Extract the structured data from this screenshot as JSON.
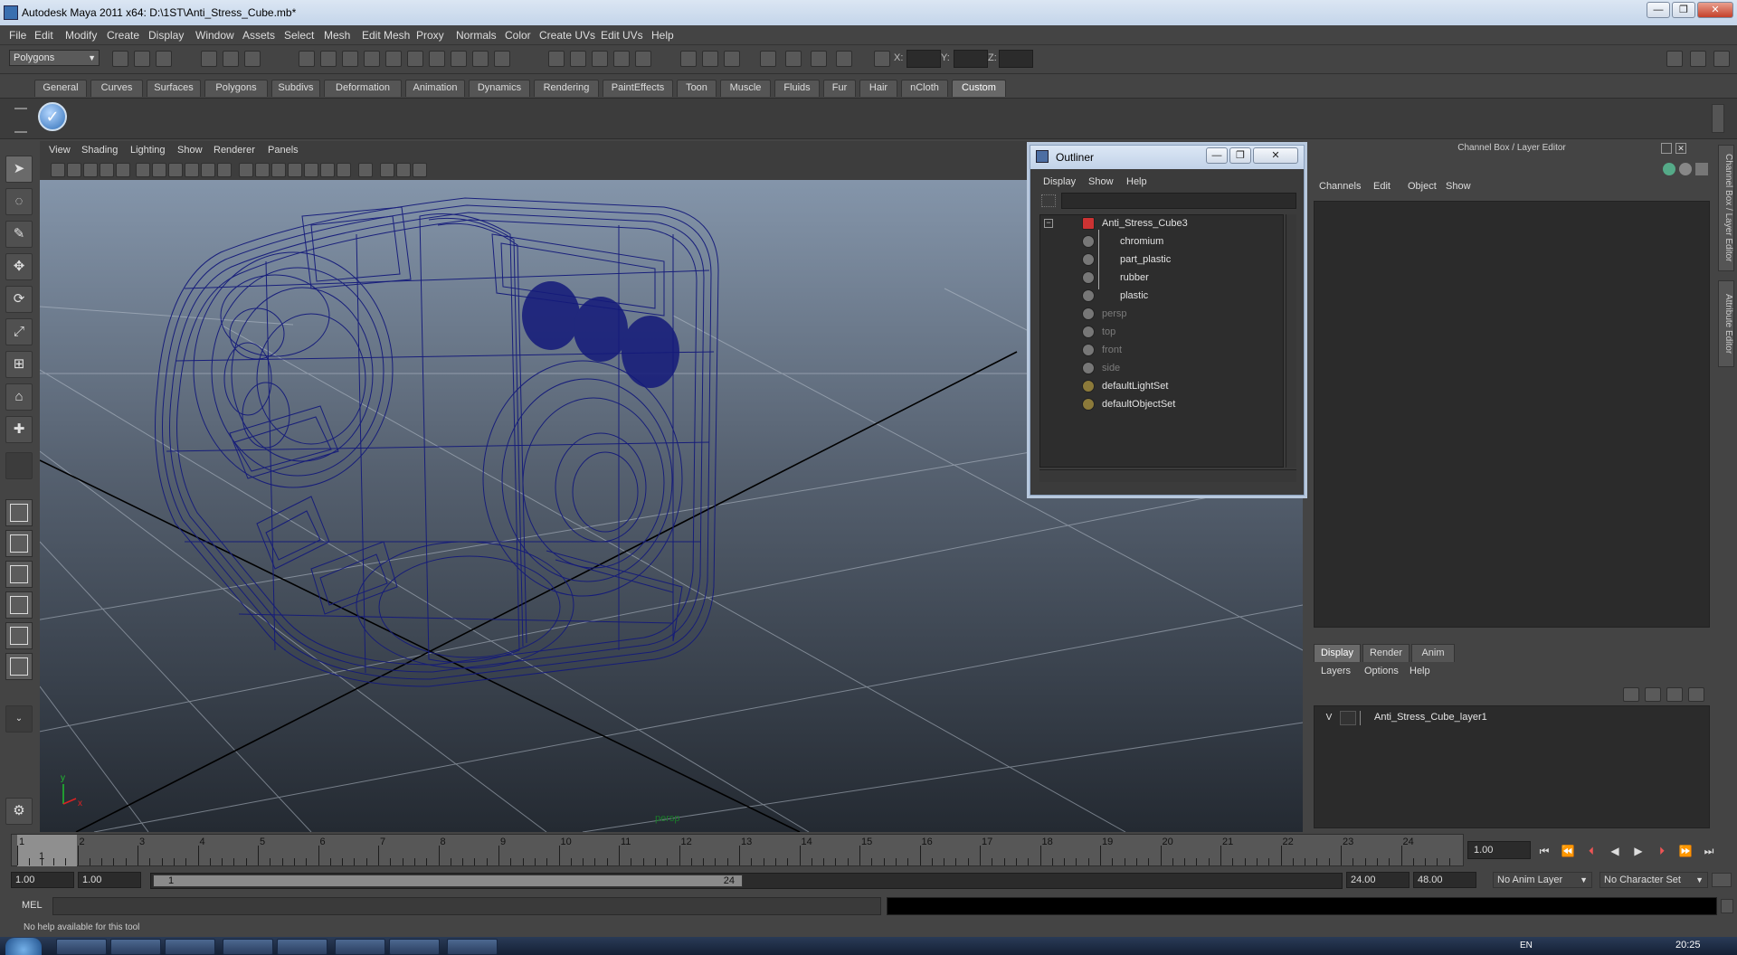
{
  "window": {
    "title": "Autodesk Maya 2011 x64: D:\\1ST\\Anti_Stress_Cube.mb*",
    "minimize": "—",
    "maximize": "❐",
    "close": "✕"
  },
  "menubar": [
    "File",
    "Edit",
    "Modify",
    "Create",
    "Display",
    "Window",
    "Assets",
    "Select",
    "Mesh",
    "Edit Mesh",
    "Proxy",
    "Normals",
    "Color",
    "Create UVs",
    "Edit UVs",
    "Help"
  ],
  "statusline": {
    "mode": "Polygons",
    "x_label": "X:",
    "y_label": "Y:",
    "z_label": "Z:"
  },
  "shelf": {
    "tabs": [
      "General",
      "Curves",
      "Surfaces",
      "Polygons",
      "Subdivs",
      "Deformation",
      "Animation",
      "Dynamics",
      "Rendering",
      "PaintEffects",
      "Toon",
      "Muscle",
      "Fluids",
      "Fur",
      "Hair",
      "nCloth",
      "Custom"
    ],
    "active_tab": "Custom"
  },
  "panel": {
    "menu": [
      "View",
      "Shading",
      "Lighting",
      "Show",
      "Renderer",
      "Panels"
    ],
    "camera": "persp"
  },
  "outliner": {
    "title": "Outliner",
    "menu": [
      "Display",
      "Show",
      "Help"
    ],
    "items": [
      {
        "label": "Anti_Stress_Cube3",
        "dim": false
      },
      {
        "label": "chromium",
        "dim": false
      },
      {
        "label": "part_plastic",
        "dim": false
      },
      {
        "label": "rubber",
        "dim": false
      },
      {
        "label": "plastic",
        "dim": false
      },
      {
        "label": "persp",
        "dim": true
      },
      {
        "label": "top",
        "dim": true
      },
      {
        "label": "front",
        "dim": true
      },
      {
        "label": "side",
        "dim": true
      },
      {
        "label": "defaultLightSet",
        "dim": false
      },
      {
        "label": "defaultObjectSet",
        "dim": false
      }
    ]
  },
  "channelbox": {
    "title": "Channel Box / Layer Editor",
    "menu": [
      "Channels",
      "Edit",
      "Object",
      "Show"
    ],
    "side_tabs": [
      "Channel Box / Layer Editor",
      "Attribute Editor"
    ]
  },
  "layereditor": {
    "tabs": [
      "Display",
      "Render",
      "Anim"
    ],
    "active_tab": "Display",
    "menu": [
      "Layers",
      "Options",
      "Help"
    ],
    "layer": {
      "visible": "V",
      "name": "Anti_Stress_Cube_layer1"
    }
  },
  "timeslider": {
    "ticks": [
      "1",
      "2",
      "3",
      "4",
      "5",
      "6",
      "7",
      "8",
      "9",
      "10",
      "11",
      "12",
      "13",
      "14",
      "15",
      "16",
      "17",
      "18",
      "19",
      "20",
      "21",
      "22",
      "23",
      "24"
    ],
    "current_frame_marker": "1",
    "current_frame": "1.00"
  },
  "rangeslider": {
    "start_time": "1.00",
    "playback_start": "1.00",
    "range_start_label": "1",
    "range_end_label": "24",
    "playback_end": "24.00",
    "end_time": "48.00",
    "anim_layer": "No Anim Layer",
    "character_set": "No Character Set"
  },
  "cmdline": {
    "label": "MEL",
    "help": "No help available for this tool"
  },
  "taskbar": {
    "lang": "EN",
    "clock": "20:25"
  },
  "colors": {
    "wireframe": "#141a7a",
    "accent": "#6a6a6a",
    "ui_bg": "#444444"
  }
}
